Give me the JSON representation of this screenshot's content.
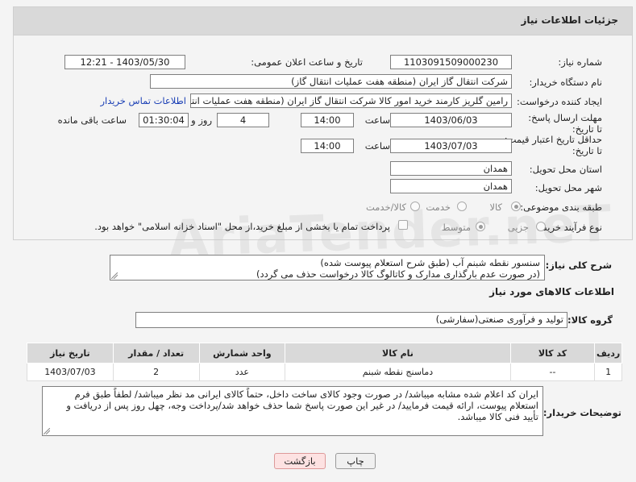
{
  "page_title": "جزئیات اطلاعات نیاز",
  "watermark": "AriaTender.neT",
  "fields": {
    "need_number_label": "شماره نیاز:",
    "need_number": "1103091509000230",
    "announce_label": "تاریخ و ساعت اعلان عمومی:",
    "announce_value": "1403/05/30 - 12:21",
    "buyer_org_label": "نام دستگاه خریدار:",
    "buyer_org": "شرکت انتقال گاز ایران (منطقه هفت عملیات انتقال گاز)",
    "requester_label": "ایجاد کننده درخواست:",
    "requester": "رامین گلریز کارمند خرید امور کالا شرکت انتقال گاز ایران (منطقه هفت عملیات انتق",
    "contact_link": "اطلاعات تماس خریدار",
    "deadline_label": "مهلت ارسال پاسخ: تا تاریخ:",
    "deadline_date": "1403/06/03",
    "time_label": "ساعت",
    "deadline_time": "14:00",
    "days": "4",
    "days_label": "روز و",
    "remaining": "01:30:04",
    "remaining_label": "ساعت باقی مانده",
    "validity_label": "حداقل تاریخ اعتبار قیمت: تا تاریخ:",
    "validity_date": "1403/07/03",
    "validity_time": "14:00",
    "province_label": "استان محل تحویل:",
    "province": "همدان",
    "city_label": "شهر محل تحویل:",
    "city": "همدان",
    "category_label": "طبقه بندی موضوعی:",
    "category_options": [
      "کالا",
      "خدمت",
      "کالا/خدمت"
    ],
    "process_label": "نوع فرآیند خرید :",
    "process_options": [
      "جزیی",
      "متوسط"
    ],
    "payment_note": "پرداخت تمام یا بخشی از مبلغ خرید،از محل \"اسناد خزانه اسلامی\" خواهد بود."
  },
  "description": {
    "label": "شرح کلی نیاز:",
    "line1": "سنسور نقطه شبنم آب (طبق شرح استعلام پیوست شده)",
    "line2": "(در صورت عدم بارگذاری مدارک و کاتالوگ کالا درخواست حذف می گردد)"
  },
  "goods_section_title": "اطلاعات کالاهای مورد نیاز",
  "goods_group_label": "گروه کالا:",
  "goods_group": "تولید و فرآوری صنعتی(سفارشی)",
  "table": {
    "headers": [
      "ردیف",
      "کد کالا",
      "نام کالا",
      "واحد شمارش",
      "تعداد / مقدار",
      "تاریخ نیاز"
    ],
    "rows": [
      [
        "1",
        "--",
        "دماسنج نقطه شبنم",
        "عدد",
        "2",
        "1403/07/03"
      ]
    ]
  },
  "buyer_notes": {
    "label": "توضیحات خریدار:",
    "line1": "ایران کد اعلام شده مشابه میباشد/ در صورت وجود کالای ساخت داخل، حتماً کالای ایرانی مد نظر میباشد/ لطفاً طبق فرم",
    "line2": "استعلام پیوست، ارائه قیمت فرمایید/ در غیر این صورت پاسخ شما حذف خواهد شد/پرداخت وجه، چهل روز پس از دریافت و",
    "line3": "تأیید فنی کالا میباشد."
  },
  "buttons": {
    "print": "چاپ",
    "back": "بازگشت"
  }
}
